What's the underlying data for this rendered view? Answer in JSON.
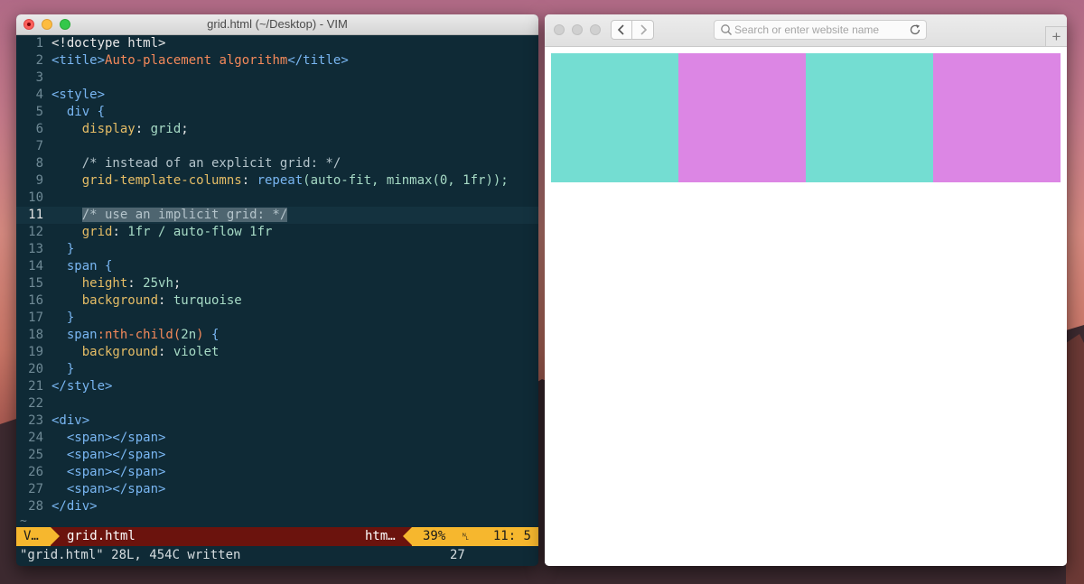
{
  "vim": {
    "title": "grid.html (~/Desktop) - VIM",
    "lines": [
      {
        "n": "1",
        "segs": [
          {
            "t": "<!doctype html>",
            "c": ""
          }
        ]
      },
      {
        "n": "2",
        "segs": [
          {
            "t": "<title>",
            "c": "c-tag"
          },
          {
            "t": "Auto-placement algorithm",
            "c": "c-title"
          },
          {
            "t": "</title>",
            "c": "c-tag"
          }
        ]
      },
      {
        "n": "3",
        "segs": []
      },
      {
        "n": "4",
        "segs": [
          {
            "t": "<style>",
            "c": "c-tag"
          }
        ]
      },
      {
        "n": "5",
        "segs": [
          {
            "t": "  div ",
            "c": "c-kw"
          },
          {
            "t": "{",
            "c": "c-kw"
          }
        ]
      },
      {
        "n": "6",
        "segs": [
          {
            "t": "    display",
            "c": "c-prop"
          },
          {
            "t": ": ",
            "c": ""
          },
          {
            "t": "grid",
            "c": "c-val"
          },
          {
            "t": ";",
            "c": ""
          }
        ]
      },
      {
        "n": "7",
        "segs": []
      },
      {
        "n": "8",
        "segs": [
          {
            "t": "    /* instead of an explicit grid: */",
            "c": "c-com"
          }
        ]
      },
      {
        "n": "9",
        "segs": [
          {
            "t": "    grid-template-columns",
            "c": "c-prop"
          },
          {
            "t": ": ",
            "c": ""
          },
          {
            "t": "repeat",
            "c": "c-func"
          },
          {
            "t": "(auto-fit, minmax(0, 1fr));",
            "c": "c-val"
          }
        ]
      },
      {
        "n": "10",
        "segs": []
      },
      {
        "n": "11",
        "cur": true,
        "segs": [
          {
            "t": "    ",
            "c": ""
          },
          {
            "t": "/* use an implicit grid: */",
            "c": "c-com hl"
          }
        ]
      },
      {
        "n": "12",
        "segs": [
          {
            "t": "    grid",
            "c": "c-prop"
          },
          {
            "t": ": ",
            "c": ""
          },
          {
            "t": "1fr / auto-flow 1fr",
            "c": "c-val"
          }
        ]
      },
      {
        "n": "13",
        "segs": [
          {
            "t": "  }",
            "c": "c-kw"
          }
        ]
      },
      {
        "n": "14",
        "segs": [
          {
            "t": "  span ",
            "c": "c-kw"
          },
          {
            "t": "{",
            "c": "c-kw"
          }
        ]
      },
      {
        "n": "15",
        "segs": [
          {
            "t": "    height",
            "c": "c-prop"
          },
          {
            "t": ": ",
            "c": ""
          },
          {
            "t": "25vh",
            "c": "c-val"
          },
          {
            "t": ";",
            "c": ""
          }
        ]
      },
      {
        "n": "16",
        "segs": [
          {
            "t": "    background",
            "c": "c-prop"
          },
          {
            "t": ": ",
            "c": ""
          },
          {
            "t": "turquoise",
            "c": "c-val"
          }
        ]
      },
      {
        "n": "17",
        "segs": [
          {
            "t": "  }",
            "c": "c-kw"
          }
        ]
      },
      {
        "n": "18",
        "segs": [
          {
            "t": "  span",
            "c": "c-kw"
          },
          {
            "t": ":nth-child(",
            "c": "c-pseudo"
          },
          {
            "t": "2n",
            "c": "c-val"
          },
          {
            "t": ") ",
            "c": "c-pseudo"
          },
          {
            "t": "{",
            "c": "c-kw"
          }
        ]
      },
      {
        "n": "19",
        "segs": [
          {
            "t": "    background",
            "c": "c-prop"
          },
          {
            "t": ": ",
            "c": ""
          },
          {
            "t": "violet",
            "c": "c-val"
          }
        ]
      },
      {
        "n": "20",
        "segs": [
          {
            "t": "  }",
            "c": "c-kw"
          }
        ]
      },
      {
        "n": "21",
        "segs": [
          {
            "t": "</style>",
            "c": "c-tag"
          }
        ]
      },
      {
        "n": "22",
        "segs": []
      },
      {
        "n": "23",
        "segs": [
          {
            "t": "<div>",
            "c": "c-tag"
          }
        ]
      },
      {
        "n": "24",
        "segs": [
          {
            "t": "  <span></span>",
            "c": "c-tag"
          }
        ]
      },
      {
        "n": "25",
        "segs": [
          {
            "t": "  <span></span>",
            "c": "c-tag"
          }
        ]
      },
      {
        "n": "26",
        "segs": [
          {
            "t": "  <span></span>",
            "c": "c-tag"
          }
        ]
      },
      {
        "n": "27",
        "segs": [
          {
            "t": "  <span></span>",
            "c": "c-tag"
          }
        ]
      },
      {
        "n": "28",
        "segs": [
          {
            "t": "</div>",
            "c": "c-tag"
          }
        ]
      }
    ],
    "tilde": "~",
    "status": {
      "mode": "V…",
      "file": "grid.html",
      "filetype": "htm…",
      "percent": "39%",
      "line_icon": "␤",
      "position": "11:  5"
    },
    "cmdline": {
      "message": "\"grid.html\" 28L, 454C written",
      "number": "27"
    }
  },
  "browser": {
    "address_placeholder": "Search or enter website name",
    "back_icon": "chevron-left-icon",
    "forward_icon": "chevron-right-icon",
    "new_tab_label": "+",
    "grid_cells": [
      {
        "color": "#74ddd2",
        "name": "turquoise"
      },
      {
        "color": "#dc86e4",
        "name": "violet"
      },
      {
        "color": "#74ddd2",
        "name": "turquoise"
      },
      {
        "color": "#dc86e4",
        "name": "violet"
      }
    ]
  }
}
